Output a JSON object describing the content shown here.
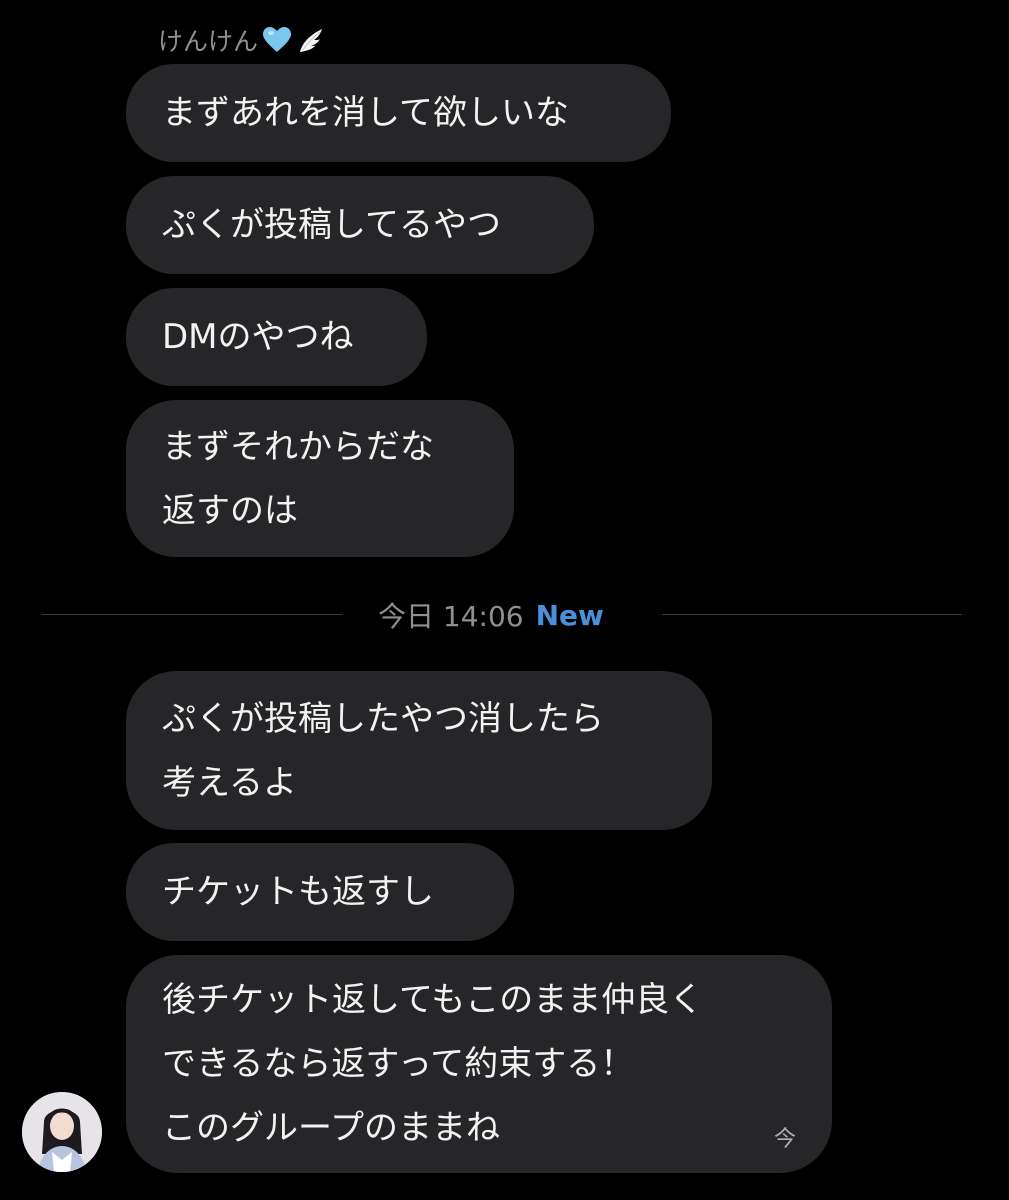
{
  "sender": {
    "name": "けんけん",
    "name_decoration_icons": [
      "light-blue-heart-icon",
      "angel-wing-icon"
    ],
    "heart_color": "#7cc7f0"
  },
  "messages": [
    {
      "text": "まずあれを消して欲しいな"
    },
    {
      "text": "ぷくが投稿してるやつ"
    },
    {
      "text": "DMのやつね"
    },
    {
      "text": "まずそれからだな\n返すのは"
    },
    {
      "text": "ぷくが投稿したやつ消したら\n考えるよ"
    },
    {
      "text": "チケットも返すし"
    },
    {
      "text": "後チケット返してもこのまま仲良く\nできるなら返すって約束する！\nこのグループのままね",
      "time": "今"
    }
  ],
  "divider": {
    "time_label": "今日 14:06",
    "new_label": "New"
  },
  "colors": {
    "background": "#000000",
    "bubble": "#262629",
    "text": "#f2f2f2",
    "muted": "#8e8e93",
    "accent_new": "#4a90d9"
  }
}
